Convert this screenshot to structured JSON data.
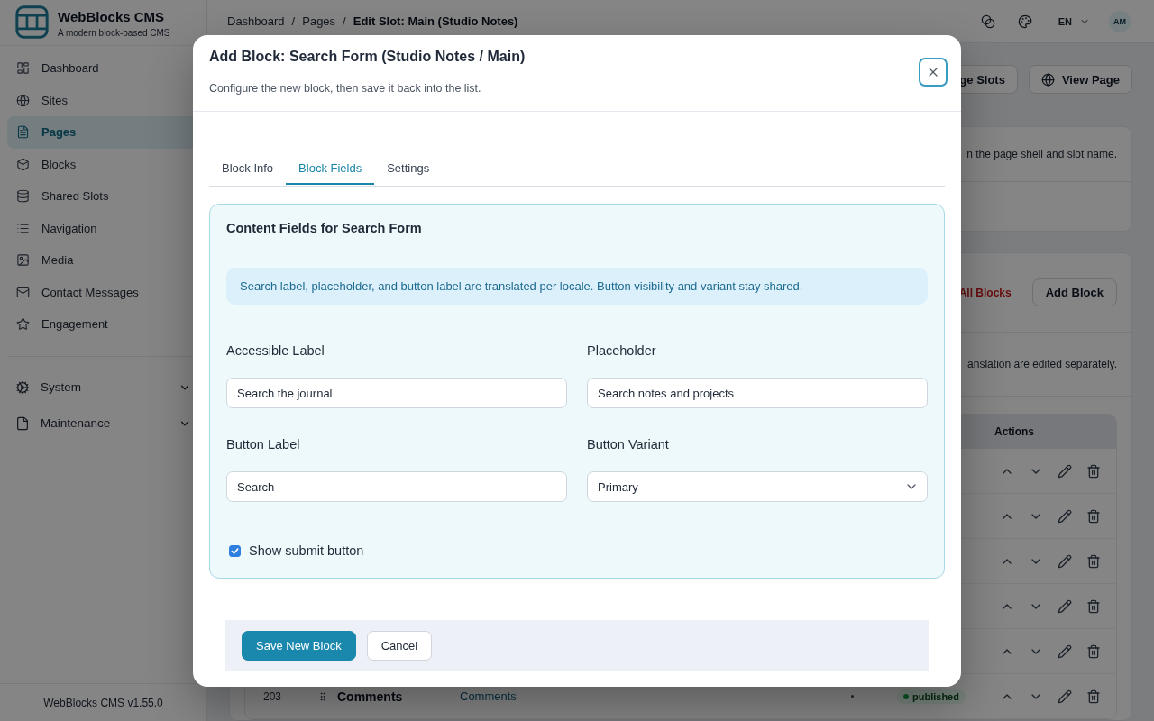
{
  "sidebar": {
    "brand": {
      "name": "WebBlocks CMS",
      "tagline": "A modern block-based CMS"
    },
    "nav": [
      {
        "label": "Dashboard",
        "selected": false
      },
      {
        "label": "Sites",
        "selected": false
      },
      {
        "label": "Pages",
        "selected": true
      },
      {
        "label": "Blocks",
        "selected": false
      },
      {
        "label": "Shared Slots",
        "selected": false
      },
      {
        "label": "Navigation",
        "selected": false
      },
      {
        "label": "Media",
        "selected": false
      },
      {
        "label": "Contact Messages",
        "selected": false
      },
      {
        "label": "Engagement",
        "selected": false
      }
    ],
    "groups": [
      {
        "label": "System",
        "expanded": false
      },
      {
        "label": "Maintenance",
        "expanded": false
      }
    ],
    "version": "WebBlocks CMS v1.55.0"
  },
  "topbar": {
    "breadcrumbs": [
      {
        "label": "Dashboard",
        "current": false,
        "separator": "/"
      },
      {
        "label": "Pages",
        "current": false,
        "separator": "/"
      },
      {
        "label": "Edit Slot: Main (Studio Notes)",
        "current": true
      }
    ],
    "language": "EN",
    "avatar": "AM"
  },
  "page": {
    "actions": [
      {
        "kind": "text",
        "label": "ge Slots"
      },
      {
        "kind": "globe",
        "label": "View Page"
      }
    ],
    "slot_card": {
      "text": "n the page shell and slot name."
    },
    "blocks_card": {
      "clear_all": "All Blocks",
      "add_block": "Add Block",
      "note": "anslation are edited separately.",
      "table": {
        "columns": [
          "Actions"
        ],
        "rows": [
          {
            "kind": "actions_only"
          },
          {
            "kind": "actions_only"
          },
          {
            "kind": "actions_only"
          },
          {
            "kind": "actions_only"
          },
          {
            "kind": "actions_only"
          },
          {
            "kind": "full",
            "id": "203",
            "name": "Comments",
            "type": "Comments",
            "status": "published"
          }
        ]
      }
    }
  },
  "modal": {
    "title": "Add Block: Search Form (Studio Notes / Main)",
    "subtitle": "Configure the new block, then save it back into the list.",
    "tabs": [
      {
        "label": "Block Info",
        "selected": false
      },
      {
        "label": "Block Fields",
        "selected": true
      },
      {
        "label": "Settings",
        "selected": false
      }
    ],
    "panel": {
      "title": "Content Fields for Search Form",
      "notice": "Search label, placeholder, and button label are translated per locale. Button visibility and variant stay shared.",
      "fields": [
        {
          "kind": "text",
          "label": "Accessible Label",
          "value": "Search the journal"
        },
        {
          "kind": "text",
          "label": "Placeholder",
          "value": "Search notes and projects"
        },
        {
          "kind": "text",
          "label": "Button Label",
          "value": "Search"
        },
        {
          "kind": "select",
          "label": "Button Variant",
          "value": "Primary"
        }
      ],
      "checkbox": {
        "label": "Show submit button",
        "checked": true
      }
    },
    "buttons": [
      {
        "kind": "primary",
        "label": "Save New Block"
      },
      {
        "kind": "secondary",
        "label": "Cancel"
      }
    ]
  }
}
